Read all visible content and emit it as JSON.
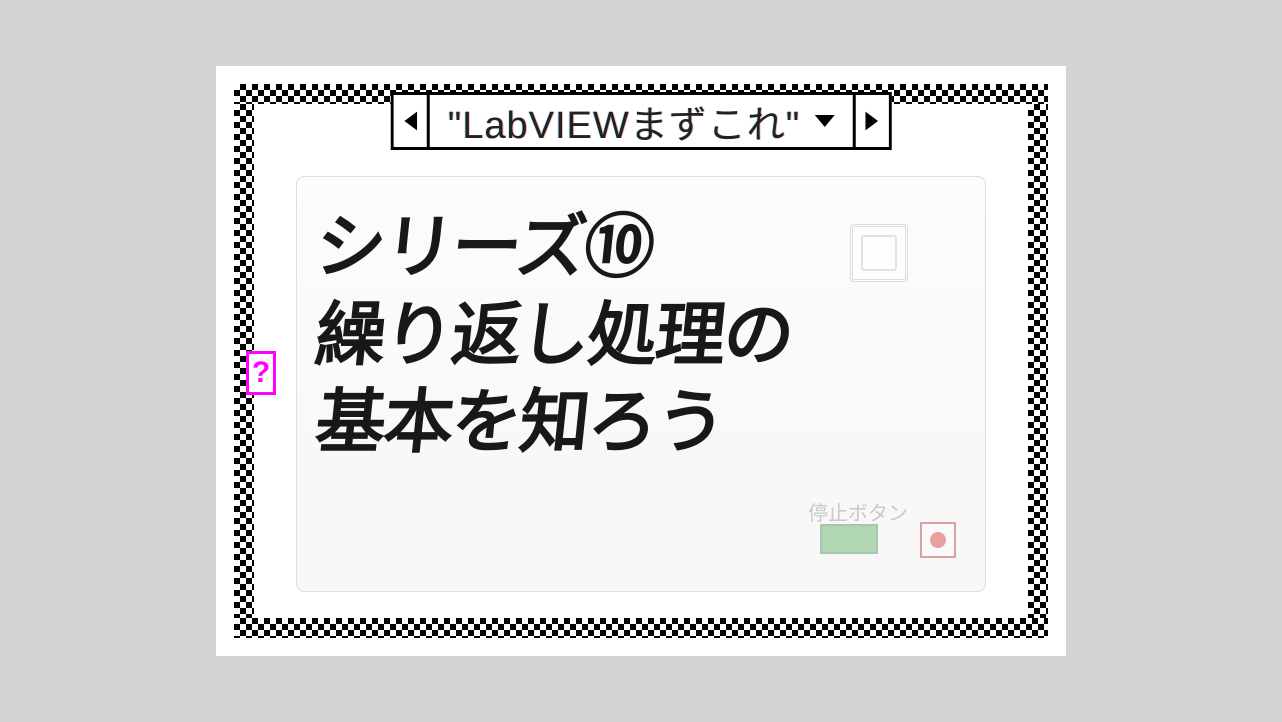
{
  "case_selector": {
    "label": "\"LabVIEWまずこれ\""
  },
  "tunnel": {
    "symbol": "?"
  },
  "title": {
    "line1": "シリーズ⑩",
    "line2": "繰り返し処理の",
    "line3": "基本を知ろう"
  },
  "background": {
    "stop_label": "停止ボタン"
  }
}
